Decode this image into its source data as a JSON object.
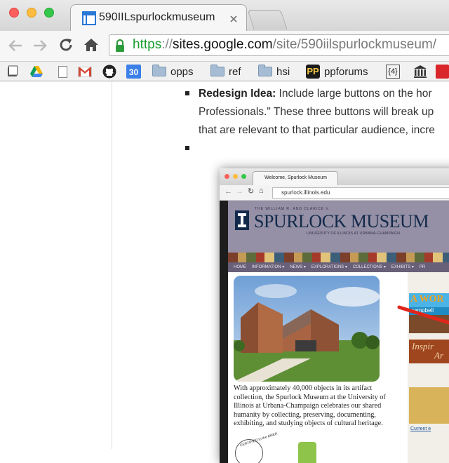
{
  "window": {
    "tab_title": "590IILspurlockmuseum",
    "url_scheme": "https",
    "url_sep": "://",
    "url_host": "sites.google.com",
    "url_path": "/site/590iilspurlockmuseum/"
  },
  "icons": {
    "back": "back-arrow-icon",
    "forward": "forward-arrow-icon",
    "reload": "reload-icon",
    "home": "home-icon",
    "lock": "lock-icon",
    "close_tab": "close-icon"
  },
  "bookmarks": {
    "calendar_day": "30",
    "opps": "opps",
    "ref": "ref",
    "hsi": "hsi",
    "ppforums": "ppforums",
    "json_badge": "{4}"
  },
  "page": {
    "bullet1_label": "Redesign Idea:",
    "bullet1_line1": " Include large buttons on the hor",
    "bullet1_line2": "Professionals.\" These three buttons will break up",
    "bullet1_line3": "that are relevant to that particular audience, incre"
  },
  "embedded": {
    "tab_title": "Welcome, Spurlock Museum",
    "url": "spurlock.illinois.edu",
    "header_small": "THE WILLIAM R. AND CLARICE V.",
    "museum_name": "SPURLOCK MUSEUM",
    "university": "UNIVERSITY OF ILLINOIS AT URBANA-CHAMPAIGN",
    "nav": [
      "HOME",
      "INFORMATION ▾",
      "NEWS ▾",
      "EXPLORATIONS ▾",
      "COLLECTIONS ▾",
      "EXHIBITS ▾",
      "PR"
    ],
    "caption": "With approximately 40,000 objects in its artifact collection, the Spurlock Museum at the University of Illinois at Urbana-Champaign celebrates our shared humanity by collecting, preserving, documenting, exhibiting, and studying objects of cultural heritage.",
    "side_banner": "A WOR",
    "side_sub": "campbell",
    "side_promo": "Inspir",
    "side_promo2": "Ar",
    "current_link": "Current e",
    "seal_text": "CERTIFIED to the AMER",
    "colors": {
      "header": "#9590a5",
      "nav": "#686078",
      "illinois_blue": "#13294b",
      "accent_red": "#e0261b",
      "link_green": "#1a9e2f"
    }
  },
  "colors": {
    "gmail_red": "#d44638",
    "drive_yellow": "#f4b400",
    "drive_green": "#0f9d58",
    "drive_blue": "#4285f4",
    "calendar_blue": "#3b7fe8"
  }
}
